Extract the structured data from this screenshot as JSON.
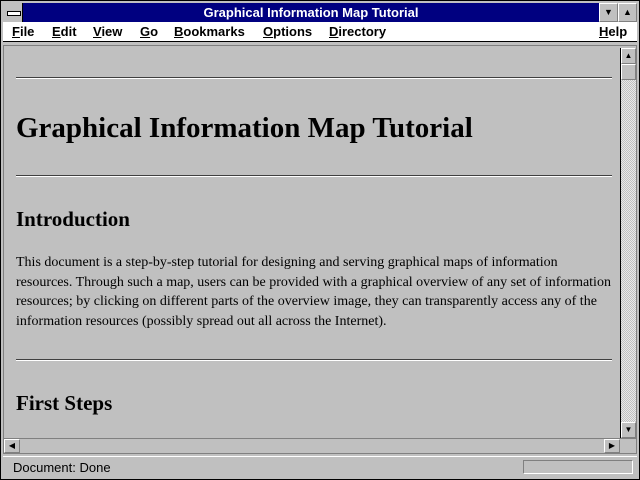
{
  "window": {
    "title": "Graphical Information Map Tutorial",
    "system_menu_icon": "system-menu-icon",
    "minimize_icon": "triangle-down",
    "maximize_icon": "triangle-up"
  },
  "menu": {
    "file": "File",
    "edit": "Edit",
    "view": "View",
    "go": "Go",
    "bookmarks": "Bookmarks",
    "options": "Options",
    "directory": "Directory",
    "help": "Help"
  },
  "document": {
    "heading": "Graphical Information Map Tutorial",
    "section1_title": "Introduction",
    "section1_text": "This document is a step-by-step tutorial for designing and serving graphical maps of information resources. Through such a map, users can be provided with a graphical overview of any set of information resources; by clicking on different parts of the overview image, they can transparently access any of the information resources (possibly spread out all across the Internet).",
    "section2_title": "First Steps"
  },
  "status": {
    "text": "Document: Done"
  },
  "colors": {
    "titlebar": "#000080",
    "background": "#c0c0c0"
  }
}
